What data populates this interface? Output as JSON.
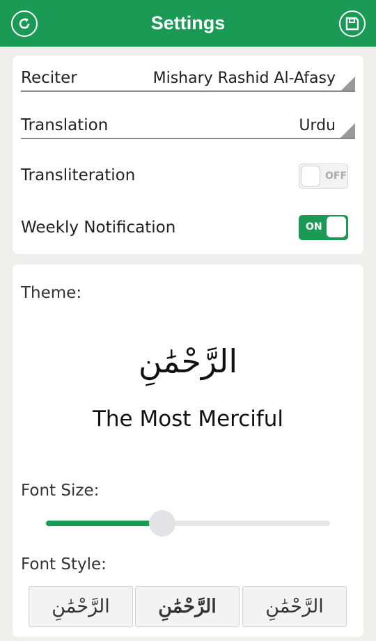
{
  "header": {
    "title": "Settings",
    "left_icon": "refresh-icon",
    "right_icon": "save-icon"
  },
  "colors": {
    "accent": "#1b9a55",
    "background": "#efefed"
  },
  "general": {
    "reciter": {
      "label": "Reciter",
      "value": "Mishary Rashid Al-Afasy"
    },
    "translation": {
      "label": "Translation",
      "value": "Urdu"
    },
    "transliteration": {
      "label": "Transliteration",
      "toggle_text": "OFF",
      "on": false
    },
    "weekly_notification": {
      "label": "Weekly Notification",
      "toggle_text": "ON",
      "on": true
    }
  },
  "theme": {
    "label": "Theme:",
    "preview_arabic": "الرَّحْمَٰنِ",
    "preview_meaning": "The Most Merciful",
    "font_size_label": "Font Size:",
    "font_size_level": 0.41,
    "font_style_label": "Font Style:",
    "font_styles": [
      "الرَّحْمَٰنِ",
      "الرَّحْمَٰنِ",
      "الرَّحْمَٰنِ"
    ]
  }
}
